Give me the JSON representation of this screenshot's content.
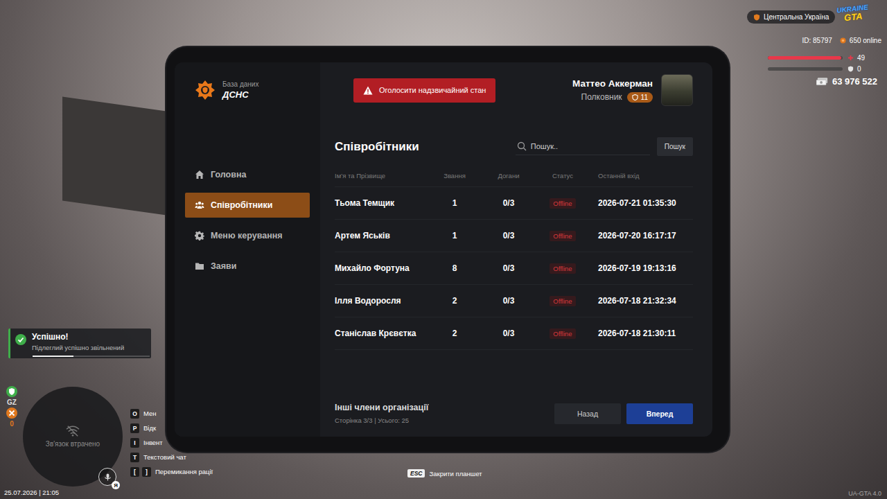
{
  "hud": {
    "region": "Центральна Україна",
    "logo": {
      "top": "UKRAINE",
      "bottom": "GTA"
    },
    "player_id": "ID: 85797",
    "online": "650 online",
    "health": {
      "value": "49",
      "level": 0.98
    },
    "armor": {
      "value": "0",
      "level": 0
    },
    "money": "63 976 522",
    "notification": {
      "title": "Успішно!",
      "text": "Підлеглий успішно звільнений",
      "level": 0.35
    },
    "zone": "GZ",
    "wanted": "0",
    "minimap": {
      "text": "Зв'язок втрачено"
    },
    "voice": {
      "badge": "Я"
    },
    "keybinds": [
      {
        "keys": [
          "O"
        ],
        "label": "Мен"
      },
      {
        "keys": [
          "P"
        ],
        "label": "Відк"
      },
      {
        "keys": [
          "I"
        ],
        "label": "Інвент"
      },
      {
        "keys": [
          "T"
        ],
        "label": "Текстовий чат"
      },
      {
        "keys": [
          "[",
          "]"
        ],
        "label": "Перемикання рації"
      }
    ],
    "datetime": "25.07.2026 | 21:05",
    "close_hint": {
      "key": "ESC",
      "label": "Закрити планшет"
    },
    "version": "UA-GTA 4.0"
  },
  "tablet": {
    "brand": {
      "subtitle": "База даних",
      "title": "ДСНС"
    },
    "emergency_button": "Оголосити надзвичайний стан",
    "user": {
      "name": "Маттео Аккерман",
      "rank": "Полковник",
      "level": "11"
    },
    "sidebar": {
      "items": [
        {
          "label": "Головна",
          "selected": false
        },
        {
          "label": "Співробітники",
          "selected": true
        },
        {
          "label": "Меню керування",
          "selected": false
        },
        {
          "label": "Заяви",
          "selected": false
        }
      ]
    },
    "page": {
      "title": "Співробітники",
      "search": {
        "placeholder": "Пошук..",
        "button": "Пошук"
      }
    },
    "table": {
      "columns": [
        "Ім’я та Прізвище",
        "Звання",
        "Догани",
        "Статус",
        "Останній вхід"
      ],
      "rows": [
        {
          "name": "Тьома Темщик",
          "rank": "1",
          "warnings": "0/3",
          "status": "Offline",
          "online": false,
          "last_login": "2026-07-21 01:35:30"
        },
        {
          "name": "Артем Яськів",
          "rank": "1",
          "warnings": "0/3",
          "status": "Offline",
          "online": false,
          "last_login": "2026-07-20 16:17:17"
        },
        {
          "name": "Михайло Фортуна",
          "rank": "8",
          "warnings": "0/3",
          "status": "Offline",
          "online": false,
          "last_login": "2026-07-19 19:13:16"
        },
        {
          "name": "Ілля Водоросля",
          "rank": "2",
          "warnings": "0/3",
          "status": "Offline",
          "online": false,
          "last_login": "2026-07-18 21:32:34"
        },
        {
          "name": "Станіслав Крєвєтка",
          "rank": "2",
          "warnings": "0/3",
          "status": "Offline",
          "online": false,
          "last_login": "2026-07-18 21:30:11"
        }
      ]
    },
    "footer": {
      "title": "Інші члени організації",
      "info": "Сторінка 3/3 | Усього: 25",
      "prev": "Назад",
      "next": "Вперед"
    }
  }
}
